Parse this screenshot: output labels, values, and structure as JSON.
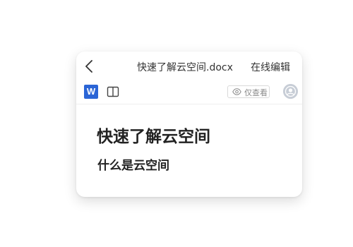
{
  "header": {
    "back_icon": "chevron-left-icon",
    "file_title": "快速了解云空间.docx",
    "edit_online_label": "在线编辑"
  },
  "toolbar": {
    "word_icon_letter": "W",
    "word_icon_color": "#2b65d6",
    "book_icon": "book-open-icon",
    "view_only_icon": "eye-icon",
    "view_only_label": "仅查看",
    "avatar_icon": "user-avatar-icon"
  },
  "document": {
    "heading": "快速了解云空间",
    "subheading": "什么是云空间"
  }
}
